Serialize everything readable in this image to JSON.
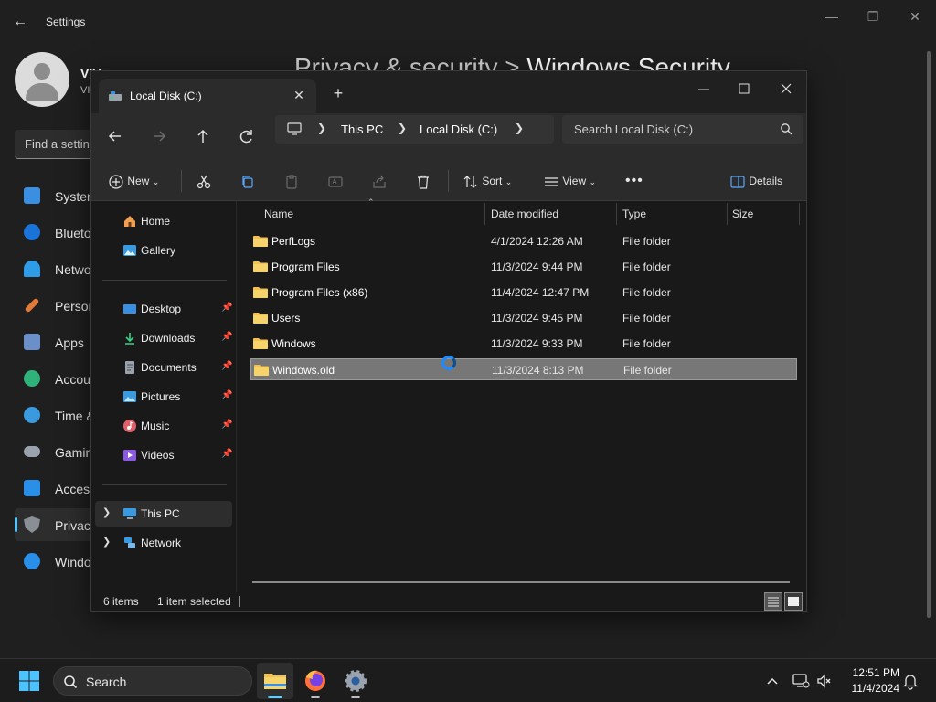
{
  "settings": {
    "title": "Settings",
    "user_name": "VIV",
    "user_sub": "VI",
    "find_placeholder": "Find a settin",
    "heading_parent": "Privacy & security",
    "heading_sep": ">",
    "heading_current": "Windows Security",
    "nav": [
      {
        "label": "System",
        "color": "#3a8fe0"
      },
      {
        "label": "Blueto",
        "color": "#1a73d9"
      },
      {
        "label": "Netwo",
        "color": "#2f9ce8"
      },
      {
        "label": "Person",
        "color": "#e07a3a"
      },
      {
        "label": "Apps",
        "color": "#6a8fc9"
      },
      {
        "label": "Accou",
        "color": "#2fb37a"
      },
      {
        "label": "Time &",
        "color": "#3a9ae0"
      },
      {
        "label": "Gamin",
        "color": "#9aa3ad"
      },
      {
        "label": "Access",
        "color": "#2a8fe8"
      },
      {
        "label": "Privacy",
        "color": "#8a8f96"
      },
      {
        "label": "Windo",
        "color": "#2a8fe8"
      }
    ]
  },
  "explorer": {
    "tab_label": "Local Disk (C:)",
    "breadcrumb": [
      "This PC",
      "Local Disk (C:)"
    ],
    "search_placeholder": "Search Local Disk (C:)",
    "commands": {
      "new": "New",
      "sort": "Sort",
      "view": "View",
      "details": "Details"
    },
    "nav_pane": {
      "home": "Home",
      "gallery": "Gallery",
      "quick_access": [
        {
          "label": "Desktop",
          "icon": "desktop-icon",
          "color": "#3a8fe0"
        },
        {
          "label": "Downloads",
          "icon": "download-icon",
          "color": "#3bd08a"
        },
        {
          "label": "Documents",
          "icon": "document-icon",
          "color": "#9aa3ad"
        },
        {
          "label": "Pictures",
          "icon": "pictures-icon",
          "color": "#3a9ae0"
        },
        {
          "label": "Music",
          "icon": "music-icon",
          "color": "#e0606a"
        },
        {
          "label": "Videos",
          "icon": "videos-icon",
          "color": "#8a5ae0"
        }
      ],
      "this_pc": "This PC",
      "network": "Network"
    },
    "columns": {
      "name": "Name",
      "date": "Date modified",
      "type": "Type",
      "size": "Size"
    },
    "files": [
      {
        "name": "PerfLogs",
        "date": "4/1/2024 12:26 AM",
        "type": "File folder"
      },
      {
        "name": "Program Files",
        "date": "11/3/2024 9:44 PM",
        "type": "File folder"
      },
      {
        "name": "Program Files (x86)",
        "date": "11/4/2024 12:47 PM",
        "type": "File folder"
      },
      {
        "name": "Users",
        "date": "11/3/2024 9:45 PM",
        "type": "File folder"
      },
      {
        "name": "Windows",
        "date": "11/3/2024 9:33 PM",
        "type": "File folder"
      },
      {
        "name": "Windows.old",
        "date": "11/3/2024 8:13 PM",
        "type": "File folder",
        "selected": true
      }
    ],
    "status": {
      "items": "6 items",
      "selected": "1 item selected"
    },
    "folder_color": "#f2c14e",
    "selection_color": "#777777"
  },
  "taskbar": {
    "search_label": "Search",
    "time": "12:51 PM",
    "date": "11/4/2024",
    "accent": "#60cdff"
  }
}
